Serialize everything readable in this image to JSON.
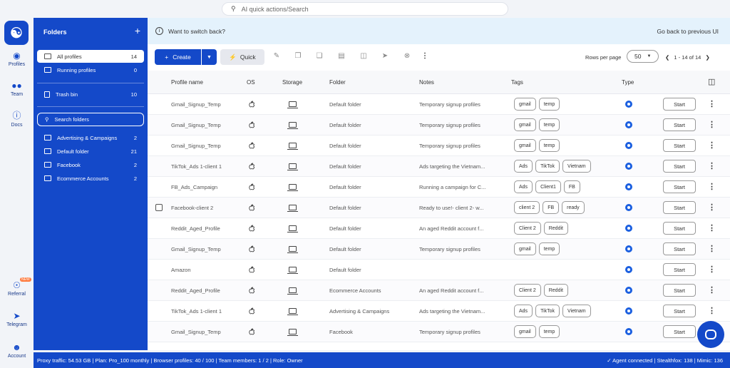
{
  "search": {
    "placeholder": "AI quick actions/Search"
  },
  "rail": {
    "items": [
      {
        "label": "Profiles",
        "icon": "profiles-icon"
      },
      {
        "label": "Team",
        "icon": "team-icon"
      },
      {
        "label": "Docs",
        "icon": "help-icon"
      },
      {
        "label": "Referral",
        "icon": "referral-icon",
        "badge": "NEW"
      },
      {
        "label": "Telegram",
        "icon": "telegram-icon"
      },
      {
        "label": "Account",
        "icon": "account-icon"
      }
    ]
  },
  "folders": {
    "title": "Folders",
    "add": "+",
    "top_items": [
      {
        "label": "All profiles",
        "count": "14"
      },
      {
        "label": "Running profiles",
        "count": "0"
      }
    ],
    "trash": {
      "label": "Trash bin",
      "count": "10"
    },
    "search_placeholder": "Search folders",
    "list": [
      {
        "label": "Advertising & Campaigns",
        "count": "2"
      },
      {
        "label": "Default folder",
        "count": "21"
      },
      {
        "label": "Facebook",
        "count": "2"
      },
      {
        "label": "Ecommerce Accounts",
        "count": "2"
      }
    ]
  },
  "banner": {
    "text": "Want to switch back?",
    "link": "Go back to previous UI"
  },
  "toolbar": {
    "create": "Create",
    "quick": "Quick",
    "rows_label": "Rows per page",
    "rows_value": "50",
    "pager": "1 - 14 of 14"
  },
  "table": {
    "headers": [
      "Profile name",
      "OS",
      "Storage",
      "Folder",
      "Notes",
      "Tags",
      "Type"
    ],
    "start_label": "Start",
    "rows": [
      {
        "name": "Gmail_Signup_Temp",
        "folder": "Default folder",
        "notes": "Temporary signup profiles",
        "tags": [
          "gmail",
          "temp"
        ]
      },
      {
        "name": "Gmail_Signup_Temp",
        "folder": "Default folder",
        "notes": "Temporary signup profiles",
        "tags": [
          "gmail",
          "temp"
        ]
      },
      {
        "name": "Gmail_Signup_Temp",
        "folder": "Default folder",
        "notes": "Temporary signup profiles",
        "tags": [
          "gmail",
          "temp"
        ]
      },
      {
        "name": "TikTok_Ads 1-client 1",
        "folder": "Default folder",
        "notes": "Ads targeting the Vietnam...",
        "tags": [
          "Ads",
          "TikTok",
          "Vietnam"
        ]
      },
      {
        "name": "FB_Ads_Campaign",
        "folder": "Default folder",
        "notes": "Running a campaign for C...",
        "tags": [
          "Ads",
          "Client1",
          "FB"
        ]
      },
      {
        "name": "Facebook-client 2",
        "folder": "Default folder",
        "notes": "Ready to use!- client 2- w...",
        "tags": [
          "client 2",
          "FB",
          "ready"
        ],
        "checkbox": true
      },
      {
        "name": "Reddit_Aged_Profile",
        "folder": "Default folder",
        "notes": "An aged Reddit account f...",
        "tags": [
          "Client 2",
          "Reddit"
        ]
      },
      {
        "name": "Gmail_Signup_Temp",
        "folder": "Default folder",
        "notes": "Temporary signup profiles",
        "tags": [
          "gmail",
          "temp"
        ]
      },
      {
        "name": "Amazon",
        "folder": "Default folder",
        "notes": "",
        "tags": []
      },
      {
        "name": "Reddit_Aged_Profile",
        "folder": "Ecommerce Accounts",
        "notes": "An aged Reddit account f...",
        "tags": [
          "Client 2",
          "Reddit"
        ]
      },
      {
        "name": "TikTok_Ads 1-client 1",
        "folder": "Advertising & Campaigns",
        "notes": "Ads targeting the Vietnam...",
        "tags": [
          "Ads",
          "TikTok",
          "Vietnam"
        ]
      },
      {
        "name": "Gmail_Signup_Temp",
        "folder": "Facebook",
        "notes": "Temporary signup profiles",
        "tags": [
          "gmail",
          "temp"
        ]
      }
    ]
  },
  "status": {
    "left": "Proxy traffic: 54.53 GB | Plan: Pro_100 monthly | Browser profiles: 40 / 100 | Team members: 1 / 2 | Role: Owner",
    "right": "Agent connected | Stealthfox: 138 | Mimic: 136"
  }
}
